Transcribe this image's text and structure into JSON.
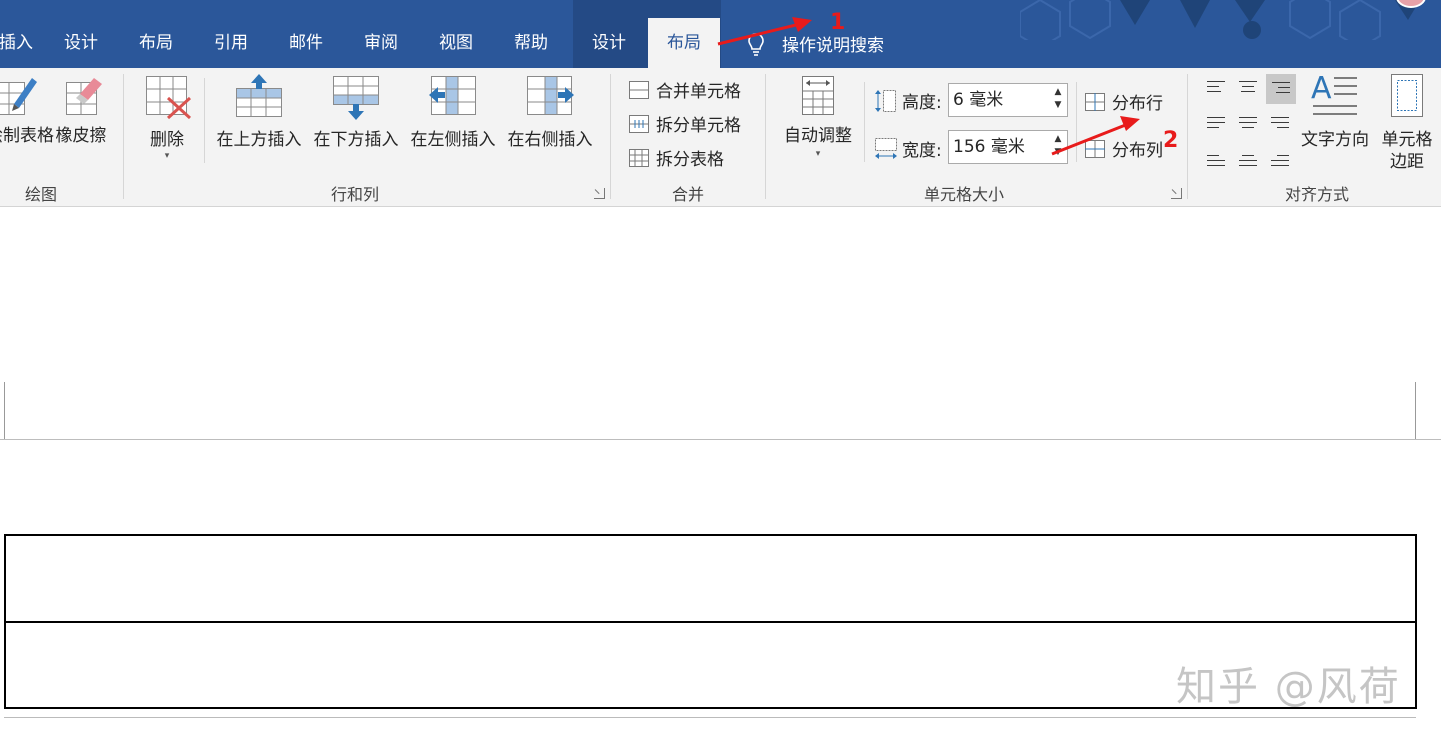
{
  "tabs": [
    {
      "label": "插入"
    },
    {
      "label": "设计"
    },
    {
      "label": "布局"
    },
    {
      "label": "引用"
    },
    {
      "label": "邮件"
    },
    {
      "label": "审阅"
    },
    {
      "label": "视图"
    },
    {
      "label": "帮助"
    },
    {
      "label": "设计"
    },
    {
      "label": "布局"
    }
  ],
  "tell_me": "操作说明搜索",
  "groups": {
    "draw": {
      "label": "绘图",
      "draw_table": "绘制表格",
      "eraser": "橡皮擦"
    },
    "rows_cols": {
      "label": "行和列",
      "delete": "删除",
      "insert_above": "在上方插入",
      "insert_below": "在下方插入",
      "insert_left": "在左侧插入",
      "insert_right": "在右侧插入"
    },
    "merge": {
      "label": "合并",
      "merge_cells": "合并单元格",
      "split_cells": "拆分单元格",
      "split_table": "拆分表格"
    },
    "cell_size": {
      "label": "单元格大小",
      "autofit": "自动调整",
      "height_label": "高度:",
      "height_value": "6 毫米",
      "width_label": "宽度:",
      "width_value": "156 毫米",
      "distribute_rows": "分布行",
      "distribute_cols": "分布列"
    },
    "alignment": {
      "label": "对齐方式",
      "text_direction": "文字方向",
      "cell_margins_line1": "单元格",
      "cell_margins_line2": "边距"
    }
  },
  "annotations": {
    "one": "1",
    "two": "2"
  },
  "watermark": "知乎 @风荷",
  "colors": {
    "tab_bar": "#2b579a",
    "ribbon": "#f3f3f3",
    "annotation": "#e81b1b"
  }
}
